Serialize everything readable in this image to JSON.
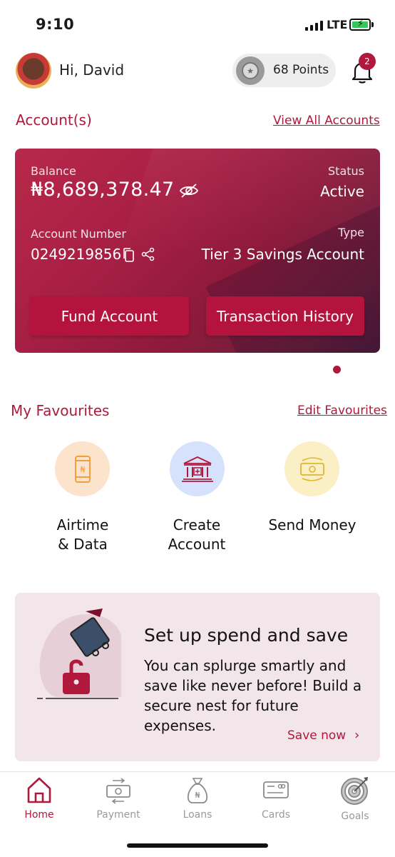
{
  "status_bar": {
    "time": "9:10",
    "network": "LTE"
  },
  "header": {
    "greeting": "Hi, David",
    "points": "68 Points",
    "notification_count": "2"
  },
  "accounts": {
    "section_title": "Account(s)",
    "view_all": "View All Accounts",
    "card": {
      "balance_label": "Balance",
      "balance": "₦8,689,378.47",
      "status_label": "Status",
      "status": "Active",
      "account_number_label": "Account Number",
      "account_number": "0249219856",
      "type_label": "Type",
      "type": "Tier 3 Savings Account",
      "fund_button": "Fund Account",
      "history_button": "Transaction History"
    }
  },
  "favourites": {
    "section_title": "My Favourites",
    "edit": "Edit Favourites",
    "items": [
      {
        "label_line1": "Airtime",
        "label_line2": "& Data",
        "icon": "phone-icon",
        "bg": "#fbe3cc"
      },
      {
        "label_line1": "Create",
        "label_line2": "Account",
        "icon": "bank-icon",
        "bg": "#d6e2fb"
      },
      {
        "label_line1": "Send Money",
        "label_line2": "",
        "icon": "cash-icon",
        "bg": "#fbefc6"
      }
    ]
  },
  "promo": {
    "title": "Set up spend and save",
    "body": "You can splurge smartly and save like never before! Build a secure nest for future expenses.",
    "cta": "Save now"
  },
  "nav": {
    "items": [
      {
        "label": "Home",
        "icon": "home-icon",
        "active": true
      },
      {
        "label": "Payment",
        "icon": "payment-icon",
        "active": false
      },
      {
        "label": "Loans",
        "icon": "loan-bag-icon",
        "active": false
      },
      {
        "label": "Cards",
        "icon": "card-icon",
        "active": false
      },
      {
        "label": "Goals",
        "icon": "target-icon",
        "active": false
      }
    ]
  },
  "colors": {
    "brand": "#b0183c",
    "card_start": "#b8284a",
    "card_end": "#4a1b3a",
    "promo_bg": "#f3e6ea"
  }
}
